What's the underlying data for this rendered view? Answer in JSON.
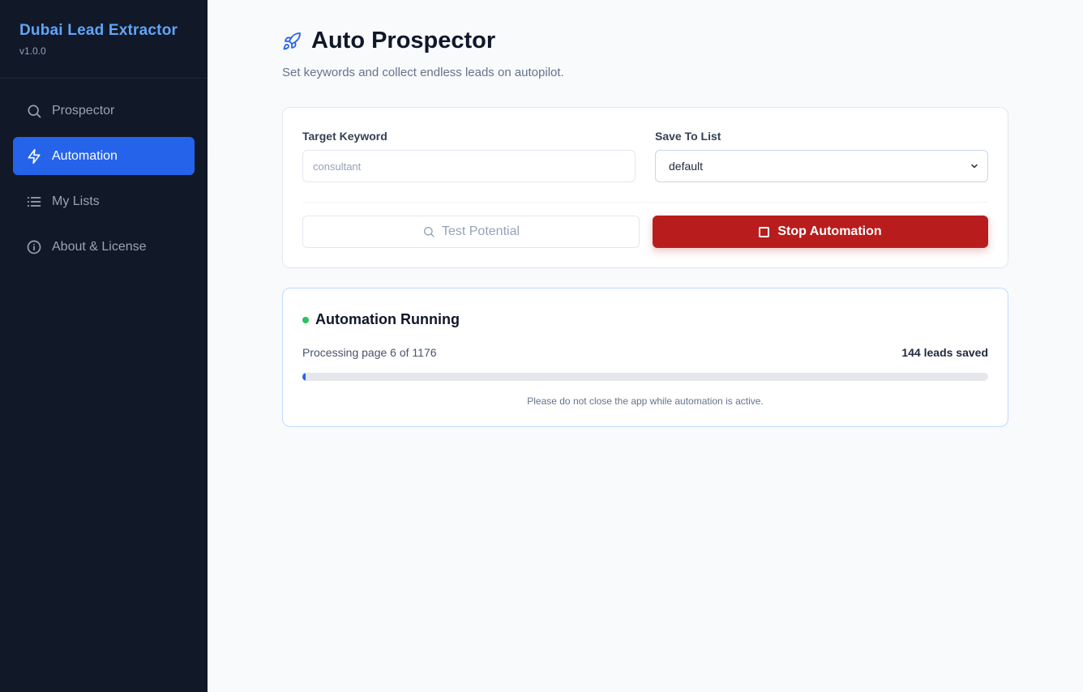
{
  "app": {
    "title": "Dubai Lead Extractor",
    "version": "v1.0.0"
  },
  "sidebar": {
    "items": [
      {
        "label": "Prospector",
        "icon": "search-icon",
        "active": false
      },
      {
        "label": "Automation",
        "icon": "zap-icon",
        "active": true
      },
      {
        "label": "My Lists",
        "icon": "list-icon",
        "active": false
      },
      {
        "label": "About & License",
        "icon": "info-icon",
        "active": false
      }
    ]
  },
  "header": {
    "icon": "rocket-icon",
    "title": "Auto Prospector",
    "subtitle": "Set keywords and collect endless leads on autopilot."
  },
  "form": {
    "keyword_label": "Target Keyword",
    "keyword_value": "consultant",
    "list_label": "Save To List",
    "list_selected": "default",
    "test_button": "Test Potential",
    "stop_button": "Stop Automation"
  },
  "status": {
    "title": "Automation Running",
    "progress_text": "Processing page 6 of 1176",
    "leads_saved": "144 leads saved",
    "progress_fraction": 0.0051,
    "note": "Please do not close the app while automation is active."
  },
  "colors": {
    "accent": "#2563eb",
    "sidebar_bg": "#111827",
    "brand": "#60a5fa",
    "danger": "#b91c1c",
    "success": "#22c55e"
  }
}
